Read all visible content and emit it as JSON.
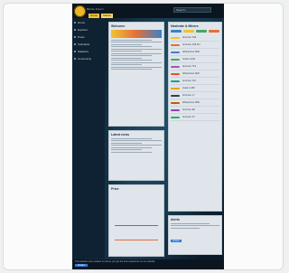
{
  "header": {
    "brand": "Bitcoin Forum",
    "tabs": [
      "Home",
      "Market"
    ],
    "search_placeholder": "Search..."
  },
  "sidebar": {
    "items": [
      "Home",
      "Explorer",
      "Pools",
      "Calculator",
      "Statistics",
      "Community"
    ]
  },
  "panels": {
    "welcome_title": "Welcome",
    "hashrate_title": "Hashrate & Miners",
    "chart_title": "Price",
    "news_title": "Latest news",
    "alerts_title": "Alerts"
  },
  "packages": [
    {
      "label": "Antminer S19",
      "color": "#f2c230"
    },
    {
      "label": "Antminer S19 Pro",
      "color": "#e36f3c"
    },
    {
      "label": "Whatsminer M30",
      "color": "#3b82c4"
    },
    {
      "label": "Avalon 1246",
      "color": "#4aa36c"
    },
    {
      "label": "Antminer T19",
      "color": "#9b59b6"
    },
    {
      "label": "Whatsminer M20",
      "color": "#e74c3c"
    },
    {
      "label": "Antminer S17",
      "color": "#16a085"
    },
    {
      "label": "Avalon 1166",
      "color": "#f39c12"
    },
    {
      "label": "Antminer L7",
      "color": "#2c3e50"
    },
    {
      "label": "Whatsminer M50",
      "color": "#d35400"
    },
    {
      "label": "Antminer E9",
      "color": "#8e44ad"
    },
    {
      "label": "Antminer K7",
      "color": "#27ae60"
    }
  ],
  "footer": {
    "cookie_text": "This website uses cookies to ensure you get the best experience on our website.",
    "accept_label": "Accept"
  },
  "colors": {
    "brand": "#f2c230",
    "accent": "#2d7ad6",
    "background": "#0b1a29"
  }
}
